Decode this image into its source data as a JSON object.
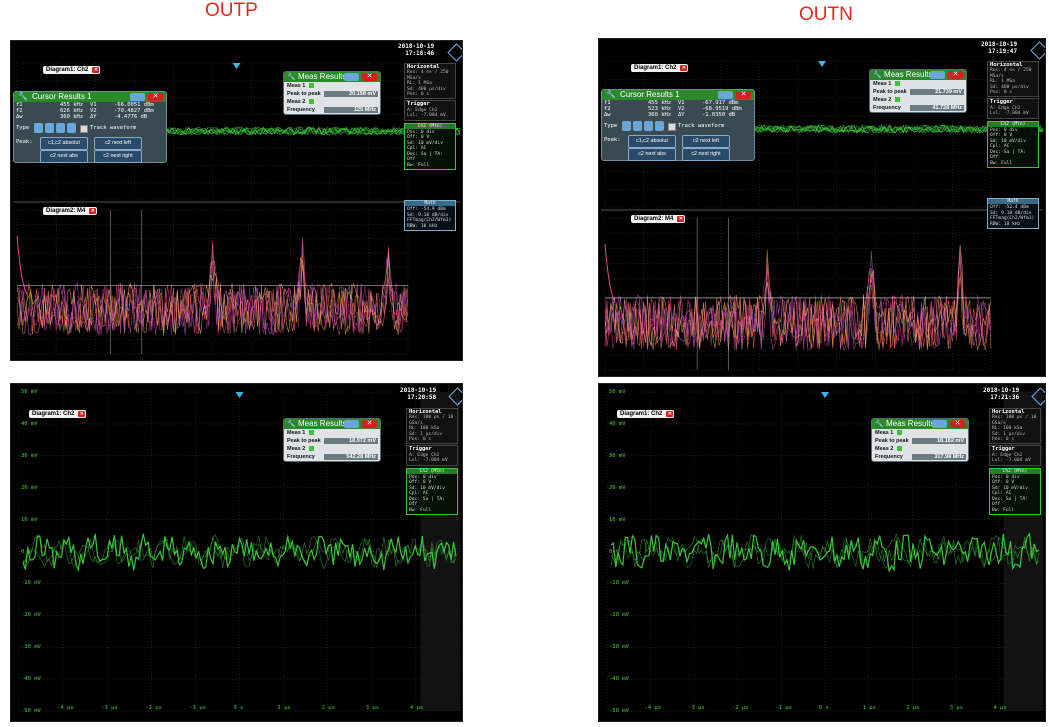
{
  "labels": {
    "left": "OUTP",
    "right": "OUTN"
  },
  "colors": {
    "trace": "#3ecf3e",
    "label": "#e8281c",
    "accent": "#2a8a2a",
    "spectrum": "#e0459a"
  },
  "panels": [
    {
      "id": "tl",
      "timestamp": {
        "date": "2018-10-19",
        "time": "17:18:46"
      },
      "tab1": "Diagram1: Ch2",
      "tab2": "Diagram2: M4",
      "meas": {
        "title": "Meas Results",
        "rows": [
          {
            "label": "Meas 1"
          },
          {
            "label": "Peak to peak",
            "value": "20.158 mV"
          },
          {
            "label": "Meas 2"
          },
          {
            "label": "Frequency",
            "value": "125 MHz"
          }
        ]
      },
      "horizontal": [
        "Horizontal",
        "Res: 4 ns / 250 MSa/s",
        "RL: 1 MSa",
        "Sd: 400 µs/div",
        "Pos: 0 s"
      ],
      "trigger": [
        "Trigger",
        "A: Edge  Ch2",
        "Lvl: -7.004 mV"
      ],
      "ch": [
        "Ch2 (Mtn)",
        "Pos: 0 div",
        "Off: 0 V",
        "Sd: 10 mV/div",
        "Cpl: AC",
        "Dec: Sa | TA: Off",
        "Bw: Full"
      ],
      "math": [
        "Math",
        "Off: -54.9 dBm",
        "Sd: 9.18 dB/div",
        "FFTmag(Ch2/Wfm1)",
        "RBW: 10 kHz"
      ],
      "cursor": {
        "title": "Cursor Results 1",
        "rows": [
          [
            "f1",
            "455 kHz",
            "V1",
            "-66.0051 dBm"
          ],
          [
            "f2",
            "626 kHz",
            "V2",
            "-70.4827 dBm"
          ],
          [
            "Δw",
            "360 kHz",
            "ΔY",
            "-4.4776 dB"
          ]
        ],
        "type_label": "Type",
        "track_label": "Track waveform",
        "peak_label": "Peak:",
        "btns": [
          "c1,c2 absolut",
          "c2 next left",
          "c2 next abs",
          "c2 next right"
        ]
      }
    },
    {
      "id": "tr",
      "timestamp": {
        "date": "2018-10-19",
        "time": "17:19:47"
      },
      "tab1": "Diagram1: Ch2",
      "tab2": "Diagram2: M4",
      "meas": {
        "title": "Meas Results",
        "rows": [
          {
            "label": "Meas 1"
          },
          {
            "label": "Peak to peak",
            "value": "21.739 mV"
          },
          {
            "label": "Meas 2"
          },
          {
            "label": "Frequency",
            "value": "41.728 MHz"
          }
        ]
      },
      "horizontal": [
        "Horizontal",
        "Res: 4 ns / 250 MSa/s",
        "RL: 1 MSa",
        "Sd: 400 µs/div",
        "Pos: 0 s"
      ],
      "trigger": [
        "Trigger",
        "A: Edge  Ch2",
        "Lvl: -7.004 mV"
      ],
      "ch": [
        "Ch2 (Mtn)",
        "Pos: 0 div",
        "Off: 0 V",
        "Sd: 10 mV/div",
        "Cpl: AC",
        "Dec: Sa | TA: Off",
        "Bw: Full"
      ],
      "math": [
        "Math",
        "Off: -52.4 dBm",
        "Sd: 9.10 dB/div",
        "FFTmag(Ch2/Wfm1)",
        "RBW: 10 kHz"
      ],
      "cursor": {
        "title": "Cursor Results 1",
        "rows": [
          [
            "f1",
            "455 kHz",
            "V1",
            "-67.917 dBm"
          ],
          [
            "f2",
            "523 kHz",
            "V2",
            "-68.9519 dBm"
          ],
          [
            "Δw",
            "360 kHz",
            "ΔY",
            "-1.0350 dB"
          ]
        ],
        "type_label": "Type",
        "track_label": "Track waveform",
        "peak_label": "Peak:",
        "btns": [
          "c1,c2 absolut",
          "c2 next left",
          "c2 next abs",
          "c2 next right"
        ]
      }
    },
    {
      "id": "bl",
      "timestamp": {
        "date": "2018-10-19",
        "time": "17:20:58"
      },
      "tab1": "Diagram1: Ch2",
      "meas": {
        "title": "Meas Results",
        "rows": [
          {
            "label": "Meas 1"
          },
          {
            "label": "Peak to peak",
            "value": "18.972 mV"
          },
          {
            "label": "Meas 2"
          },
          {
            "label": "Frequency",
            "value": "542.28 MHz"
          }
        ]
      },
      "horizontal": [
        "Horizontal",
        "Res: 100 ps / 10 GSa/s",
        "RL: 100 kSa",
        "Sd: 1 µs/div",
        "Pos: 0 s"
      ],
      "trigger": [
        "Trigger",
        "A: Edge  Ch2",
        "Lvl: -7.004 mV"
      ],
      "ch": [
        "Ch2 (Mtn)",
        "Pos: 0 div",
        "Off: 0 V",
        "Sd: 10 mV/div",
        "Cpl: AC",
        "Dec: Sa | TA: Off",
        "Bw: Full"
      ],
      "yticks": [
        "50 mV",
        "40 mV",
        "30 mV",
        "20 mV",
        "10 mV",
        "0 V",
        "-10 mV",
        "-20 mV",
        "-30 mV",
        "-40 mV",
        "-50 mV"
      ],
      "xticks": [
        "-4 µs",
        "-3 µs",
        "-2 µs",
        "-1 µs",
        "0 s",
        "1 µs",
        "2 µs",
        "3 µs",
        "4 µs"
      ]
    },
    {
      "id": "br",
      "timestamp": {
        "date": "2018-10-19",
        "time": "17:21:36"
      },
      "tab1": "Diagram1: Ch2",
      "meas": {
        "title": "Meas Results",
        "rows": [
          {
            "label": "Meas 1"
          },
          {
            "label": "Peak to peak",
            "value": "18.182 mV"
          },
          {
            "label": "Meas 2"
          },
          {
            "label": "Frequency",
            "value": "317.98 MHz"
          }
        ]
      },
      "horizontal": [
        "Horizontal",
        "Res: 100 ps / 10 GSa/s",
        "RL: 100 kSa",
        "Sd: 1 µs/div",
        "Pos: 0 s"
      ],
      "trigger": [
        "Trigger",
        "A: Edge  Ch2",
        "Lvl: -7.004 mV"
      ],
      "ch": [
        "Ch2 (Mtn)",
        "Pos: 0 div",
        "Off: 0 V",
        "Sd: 10 mV/div",
        "Cpl: AC",
        "Dec: Sa | TA: Off",
        "Bw: Full"
      ],
      "yticks": [
        "50 mV",
        "40 mV",
        "30 mV",
        "20 mV",
        "10 mV",
        "0 V",
        "-10 mV",
        "-20 mV",
        "-30 mV",
        "-40 mV",
        "-50 mV"
      ],
      "xticks": [
        "-4 µs",
        "-3 µs",
        "-2 µs",
        "-1 µs",
        "0 s",
        "1 µs",
        "2 µs",
        "3 µs",
        "4 µs"
      ]
    }
  ]
}
